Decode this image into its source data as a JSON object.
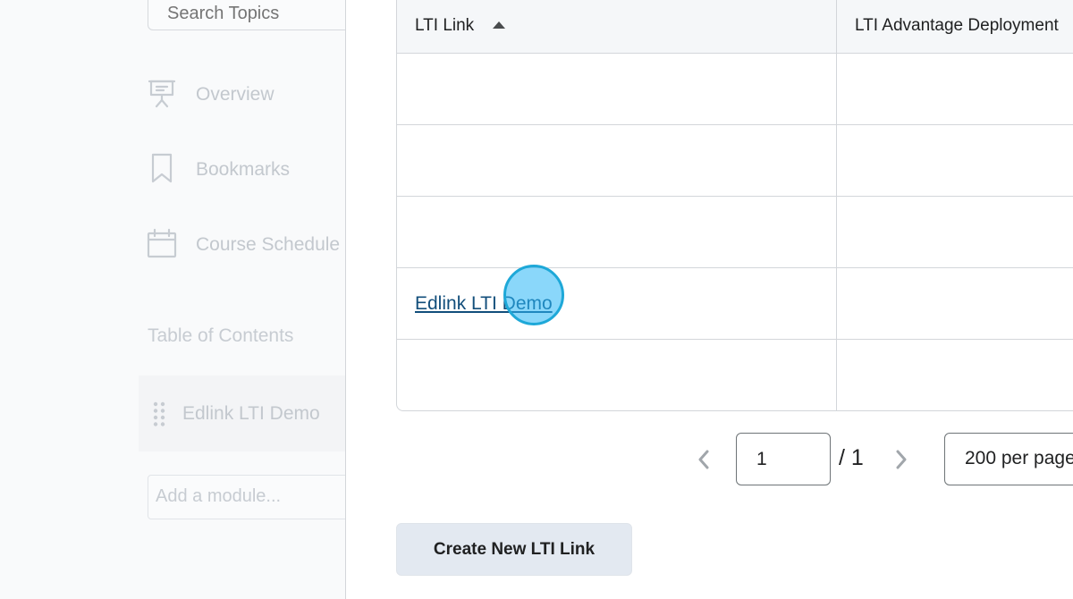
{
  "sidebar": {
    "search_placeholder": "Search Topics",
    "items": [
      {
        "label": "Overview",
        "icon": "presentation-board-icon"
      },
      {
        "label": "Bookmarks",
        "icon": "bookmark-icon"
      },
      {
        "label": "Course Schedule",
        "icon": "calendar-icon"
      }
    ],
    "toc_heading": "Table of Contents",
    "toc_items": [
      {
        "label": "Edlink LTI Demo",
        "icon": "drag-handle-icon"
      }
    ],
    "add_module_placeholder": "Add a module..."
  },
  "table": {
    "columns": [
      "LTI Link",
      "LTI Advantage Deployment"
    ],
    "sort": {
      "column": "LTI Link",
      "direction": "ascending"
    },
    "rows": [
      {
        "link": ""
      },
      {
        "link": ""
      },
      {
        "link": ""
      },
      {
        "link": "Edlink LTI Demo"
      },
      {
        "link": ""
      }
    ]
  },
  "pagination": {
    "current_page": "1",
    "total_label": "/ 1",
    "per_page_label": "200 per page"
  },
  "actions": {
    "create_label": "Create New LTI Link"
  },
  "colors": {
    "link": "#124e7b",
    "button_bg": "#e3e9f1",
    "click_marker": "#29b6f6"
  }
}
